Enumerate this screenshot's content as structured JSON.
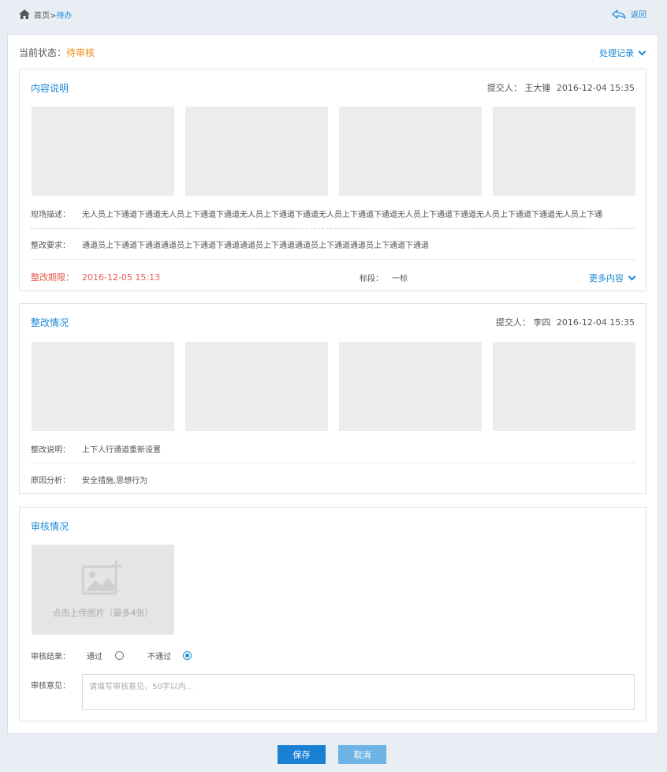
{
  "breadcrumb": {
    "home": "首页",
    "separator": ">",
    "current": "待办"
  },
  "back_label": "返回",
  "status": {
    "label": "当前状态：",
    "value": "待审核"
  },
  "records_label": "处理记录",
  "content_card": {
    "title": "内容说明",
    "submitter_label": "提交人：",
    "submitter_name": "王大锤",
    "submit_time": "2016-12-04 15:35",
    "description_label": "现场描述：",
    "description": "无人员上下通道下通道无人员上下通道下通道无人员上下通道下通道无人员上下通道下通道无人员上下通道下通道无人员上下通道下通道无人员上下通",
    "requirement_label": "整改要求：",
    "requirement": "通道员上下通道下通道通道员上下通道下通道通道员上下通道通道员上下通道通道员上下通道下通道",
    "deadline_label": "整改期限：",
    "deadline": "2016-12-05 15:13",
    "section_label": "标段：",
    "section_value": "一标",
    "more_label": "更多内容"
  },
  "rectify_card": {
    "title": "整改情况",
    "submitter_label": "提交人：",
    "submitter_name": "李四",
    "submit_time": "2016-12-04 15:35",
    "note_label": "整改说明：",
    "note": "上下人行通道重新设置",
    "cause_label": "原因分析：",
    "cause": "安全措施,思想行为"
  },
  "review_card": {
    "title": "审核情况",
    "upload_text": "点击上传图片（最多4张）",
    "result_label": "审核结果：",
    "options": [
      "通过",
      "不通过"
    ],
    "selected": "不通过",
    "opinion_label": "审核意见：",
    "opinion_placeholder": "请填写审核意见，50字以内..."
  },
  "buttons": {
    "save": "保存",
    "cancel": "取消"
  },
  "colors": {
    "accent": "#1a8ad6",
    "status": "#f08a1c",
    "deadline": "#e8574f",
    "save": "#1a80d4",
    "cancel": "#6cb3e6"
  }
}
